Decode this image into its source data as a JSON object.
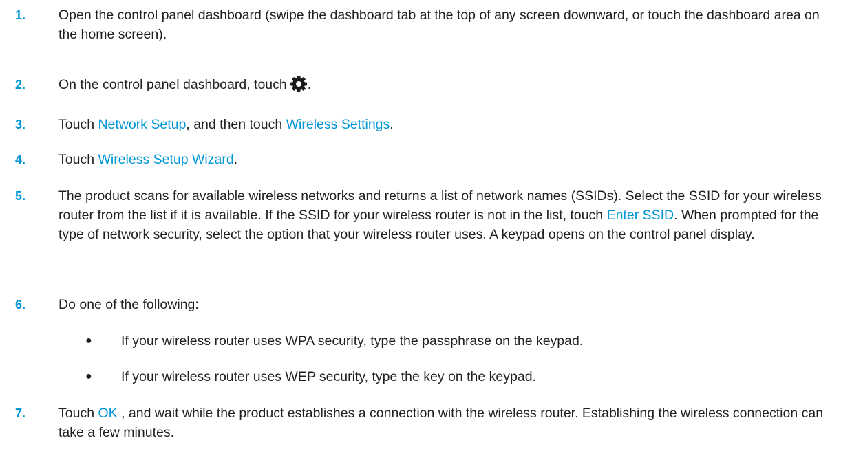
{
  "steps": [
    {
      "number": "1.",
      "text": "Open the control panel dashboard (swipe the dashboard tab at the top of any screen downward, or touch the dashboard area on the home screen)."
    },
    {
      "number": "2.",
      "text_before": "On the control panel dashboard, touch",
      "icon": "gear-icon",
      "text_after": "."
    },
    {
      "number": "3.",
      "text_a": "Touch ",
      "link_a": "Network Setup",
      "text_b": ", and then touch ",
      "link_b": "Wireless Settings",
      "text_c": "."
    },
    {
      "number": "4.",
      "text_a": "Touch ",
      "link_a": "Wireless Setup Wizard",
      "text_b": "."
    },
    {
      "number": "5.",
      "text_a": "The product scans for available wireless networks and returns a list of network names (SSIDs). Select the SSID for your wireless router from the list if it is available. If the SSID for your wireless router is not in the list, touch ",
      "link_a": "Enter SSID",
      "text_b": ". When prompted for the type of network security, select the option that your wireless router uses. A keypad opens on the control panel display."
    },
    {
      "number": "6.",
      "text": "Do one of the following:",
      "bullets": [
        {
          "symbol": "●",
          "text": "If your wireless router uses WPA security, type the passphrase on the keypad."
        },
        {
          "symbol": "●",
          "text": "If your wireless router uses WEP security, type the key on the keypad."
        }
      ]
    },
    {
      "number": "7.",
      "text_a": "Touch ",
      "link_a": "OK",
      "text_b": " , and wait while the product establishes a connection with the wireless router. Establishing the wireless connection can take a few minutes."
    }
  ],
  "colors": {
    "accent": "#0096d6",
    "text": "#231f20"
  }
}
